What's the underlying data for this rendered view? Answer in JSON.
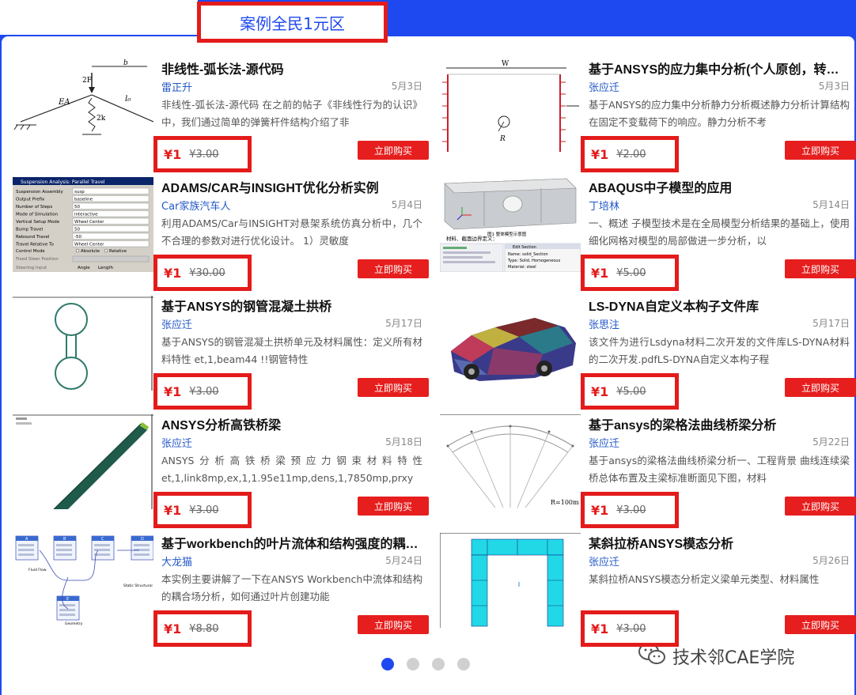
{
  "header": {
    "title": "案例全民1元区"
  },
  "buy_label": "立即购买",
  "cards": [
    {
      "title": "非线性-弧长法-源代码",
      "author": "雷正升",
      "date": "5月3日",
      "desc": "非线性-弧长法-源代码 在之前的帖子《非线性行为的认识》中，我们通过简单的弹簧杆件结构介绍了非",
      "price": "¥1",
      "orig": "¥3.00"
    },
    {
      "title": "基于ANSYS的应力集中分析(个人原创，转载请注明出处)",
      "author": "张应迁",
      "date": "5月3日",
      "desc": "基于ANSYS的应力集中分析静力分析概述静力分析计算结构在固定不变载荷下的响应。静力分析不考",
      "price": "¥1",
      "orig": "¥2.00"
    },
    {
      "title": "ADAMS/CAR与INSIGHT优化分析实例",
      "author": "Car家族汽车人",
      "date": "5月4日",
      "desc": "利用ADAMS/Car与INSIGHT对悬架系统仿真分析中，几个不合理的参数对进行优化设计。 1）灵敏度",
      "price": "¥1",
      "orig": "¥30.00"
    },
    {
      "title": "ABAQUS中子模型的应用",
      "author": "丁培林",
      "date": "5月14日",
      "desc": "一、概述 子模型技术是在全局模型分析结果的基础上，使用细化网格对模型的局部做进一步分析，以",
      "price": "¥1",
      "orig": "¥5.00"
    },
    {
      "title": "基于ANSYS的钢管混凝土拱桥",
      "author": "张应迁",
      "date": "5月17日",
      "desc": "基于ANSYS的钢管混凝土拱桥单元及材料属性：定义所有材料特性 et,1,beam44 !!钢管特性",
      "price": "¥1",
      "orig": "¥3.00"
    },
    {
      "title": "LS-DYNA自定义本构子文件库",
      "author": "张思注",
      "date": "5月17日",
      "desc": "该文件为进行Lsdyna材料二次开发的文件库LS-DYNA材料的二次开发.pdfLS-DYNA自定义本构子程",
      "price": "¥1",
      "orig": "¥5.00"
    },
    {
      "title": "ANSYS分析高铁桥梁",
      "author": "张应迁",
      "date": "5月18日",
      "desc": "ANSYS分析高铁桥梁预应力钢束材料特性 et,1,link8mp,ex,1,1.95e11mp,dens,1,7850mp,prxy",
      "price": "¥1",
      "orig": "¥3.00"
    },
    {
      "title": "基于ansys的梁格法曲线桥梁分析",
      "author": "张应迁",
      "date": "5月22日",
      "desc": "基于ansys的梁格法曲线桥梁分析一、工程背景 曲线连续梁桥总体布置及主梁标准断面见下图，材料",
      "price": "¥1",
      "orig": "¥3.00"
    },
    {
      "title": "基于workbench的叶片流体和结构强度的耦合场分析",
      "author": "大龙猫",
      "date": "5月24日",
      "desc": "本实例主要讲解了一下在ANSYS Workbench中流体和结构的耦合场分析，如何通过叶片创建功能",
      "price": "¥1",
      "orig": "¥8.80"
    },
    {
      "title": "某斜拉桥ANSYS模态分析",
      "author": "张应迁",
      "date": "5月26日",
      "desc": "某斜拉桥ANSYS模态分析定义梁单元类型、材料属性",
      "price": "¥1",
      "orig": "¥3.00"
    }
  ],
  "thumb_text": {
    "t1_b": "b",
    "t1_2f": "2F",
    "t1_ea": "EA",
    "t1_l0": "l₀",
    "t1_k": "2k",
    "t2_w": "W",
    "t2_r": "R",
    "t3_title": "Suspension Analysis: Parallel Travel",
    "t3_rows": [
      [
        "Suspension Assembly",
        "susp"
      ],
      [
        "Output Prefix",
        "baseline"
      ],
      [
        "Number of Steps",
        "50"
      ],
      [
        "Mode of Simulation",
        "interactive"
      ],
      [
        "Vertical Setup Mode",
        "Wheel Center"
      ],
      [
        "Bump Travel",
        "50"
      ],
      [
        "Rebound Travel",
        "-50"
      ],
      [
        "Travel Relative To",
        "Wheel Center"
      ]
    ],
    "t3_control": "Control Mode",
    "t3_abs": "Absolute",
    "t3_rel": "Relative",
    "t3_fixed": "Fixed Steer Position",
    "t3_steer": "Steering Input",
    "t3_angle": "Angle",
    "t3_length": "Length",
    "t4_caption": "图1 整体模型示意图",
    "t4_label": "材料、截面边界定义：",
    "t4_edit": "Edit Section",
    "t4_name": "Name: solid_Section",
    "t4_type": "Type: Solid, Homogeneous",
    "t4_material": "Material: steel",
    "t8_r": "R=100m",
    "t9_blocks": [
      "A",
      "B",
      "C",
      "D",
      "E"
    ],
    "t9_labels": [
      "Fluid Flow",
      "Geometry",
      "Static Structural"
    ]
  },
  "watermark": "技术邻CAE学院",
  "pager": {
    "count": 4,
    "active": 1
  }
}
